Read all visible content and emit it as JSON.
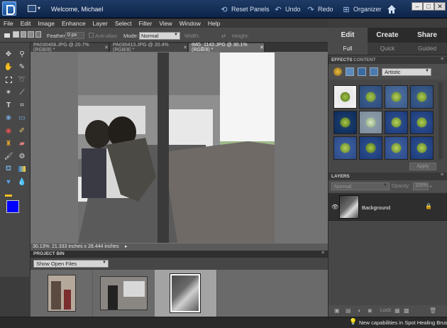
{
  "titlebar": {
    "welcome": "Welcome, Michael",
    "reset_panels": "Reset Panels",
    "undo": "Undo",
    "redo": "Redo",
    "organizer": "Organizer"
  },
  "menu": [
    "File",
    "Edit",
    "Image",
    "Enhance",
    "Layer",
    "Select",
    "Filter",
    "View",
    "Window",
    "Help"
  ],
  "options_bar": {
    "feather_label": "Feather:",
    "feather_value": "0 px",
    "anti_alias_label": "Anti-alias",
    "mode_label": "Mode:",
    "mode_value": "Normal",
    "width_label": "Width:",
    "height_label": "Height:"
  },
  "doc_tabs": [
    {
      "label": "PA030408.JPG @ 20.7% (RGB/8) *",
      "active": false
    },
    {
      "label": "PA030413.JPG @ 20.4% (RGB/8) *",
      "active": false
    },
    {
      "label": "IMG_1142.JPG @ 30.1% (RGB/8) *",
      "active": true
    }
  ],
  "mode_tabs": [
    "Edit",
    "Create",
    "Share"
  ],
  "sub_tabs": [
    "Full",
    "Quick",
    "Guided"
  ],
  "status": {
    "zoom": "30.13%",
    "dimensions": "21.333 inches x 28.444 inches"
  },
  "project_bin": {
    "header": "PROJECT BIN",
    "show_label": "Show Open Files"
  },
  "effects": {
    "tab_effects": "EFFECTS",
    "tab_content": "CONTENT",
    "category": "Artistic",
    "apply": "Apply"
  },
  "layers": {
    "header": "LAYERS",
    "blend_mode": "Normal",
    "opacity_label": "Opacity:",
    "opacity_value": "100%",
    "layer_name": "Background",
    "lock_label": "Lock:"
  },
  "app_status": "New capabilities in Spot Healing Brush.Cli"
}
